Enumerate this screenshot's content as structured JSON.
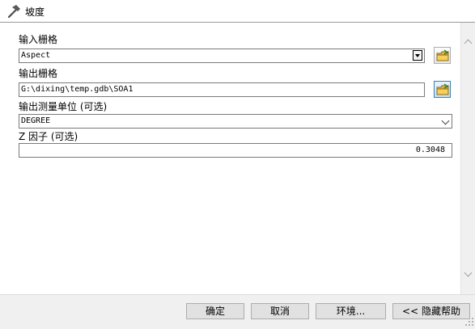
{
  "window": {
    "title": "坡度",
    "icon": "hammer-icon"
  },
  "form": {
    "input_raster": {
      "label": "输入栅格",
      "value": "Aspect",
      "browse_icon": "folder-browse-icon"
    },
    "output_raster": {
      "label": "输出栅格",
      "value": "G:\\dixing\\temp.gdb\\SOA1",
      "browse_icon": "folder-browse-icon"
    },
    "output_measurement": {
      "label": "输出测量单位 (可选)",
      "value": "DEGREE"
    },
    "z_factor": {
      "label": "Z 因子 (可选)",
      "value": "0.3048"
    }
  },
  "buttons": {
    "ok": "确定",
    "cancel": "取消",
    "environments": "环境...",
    "hide_help": "<< 隐藏帮助"
  },
  "colors": {
    "active_border": "#3c7fb1",
    "folder": "#e8b33a"
  }
}
